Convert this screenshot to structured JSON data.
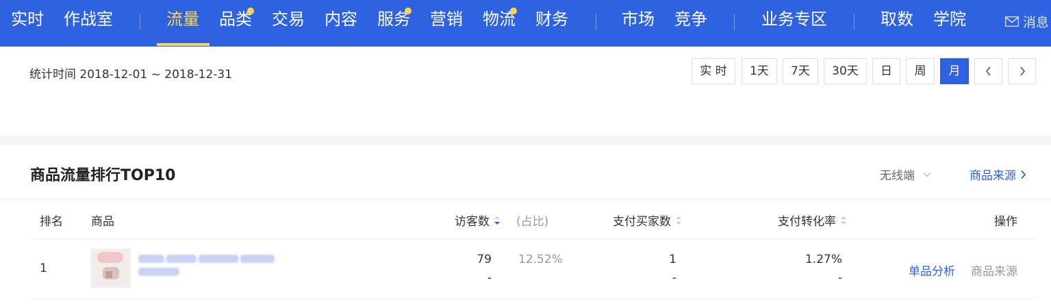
{
  "nav": {
    "items": [
      {
        "label": "实时"
      },
      {
        "label": "作战室"
      },
      {
        "label": "流量",
        "active": true
      },
      {
        "label": "品类",
        "dot": true
      },
      {
        "label": "交易"
      },
      {
        "label": "内容"
      },
      {
        "label": "服务",
        "dot": true
      },
      {
        "label": "营销"
      },
      {
        "label": "物流",
        "dot": true
      },
      {
        "label": "财务"
      },
      {
        "label": "市场"
      },
      {
        "label": "竞争"
      },
      {
        "label": "业务专区"
      },
      {
        "label": "取数"
      },
      {
        "label": "学院"
      }
    ],
    "message_label": "消息",
    "accent_color": "#ffd84a",
    "bg_color": "#2e62e0"
  },
  "date_panel": {
    "stat_label": "统计时间",
    "stat_range": "2018-12-01 ~ 2018-12-31",
    "range_buttons": [
      {
        "label": "实 时"
      },
      {
        "label": "1天"
      },
      {
        "label": "7天"
      },
      {
        "label": "30天"
      },
      {
        "label": "日"
      },
      {
        "label": "周"
      },
      {
        "label": "月",
        "active": true
      }
    ],
    "prev_icon": "chevron-left-icon",
    "next_icon": "chevron-right-icon"
  },
  "ranking": {
    "title": "商品流量排行TOP10",
    "device_select": "无线端",
    "source_link": "商品来源",
    "columns": {
      "rank": "排名",
      "goods": "商品",
      "visitors": "访客数",
      "share": "(占比)",
      "buyers": "支付买家数",
      "conversion": "支付转化率",
      "action": "操作"
    },
    "rows": [
      {
        "rank": "1",
        "visitors": "79",
        "visitors_sub": "-",
        "share": "12.52%",
        "buyers": "1",
        "buyers_sub": "-",
        "conversion": "1.27%",
        "conversion_sub": "-",
        "action_analyze": "单品分析",
        "action_source": "商品来源"
      }
    ]
  }
}
